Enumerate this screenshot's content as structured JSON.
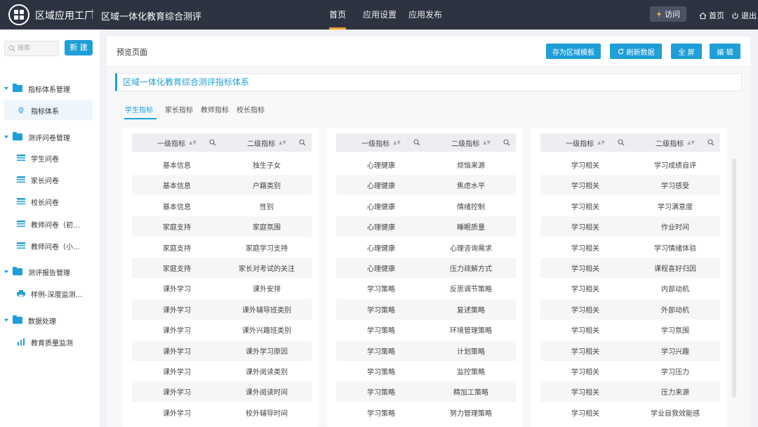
{
  "topbar": {
    "app_name": "区域应用工厂",
    "page_name": "区域一体化教育综合测评",
    "nav": [
      "首页",
      "应用设置",
      "应用发布"
    ],
    "visit_label": "访问",
    "home_label": "首页",
    "logout_label": "退出",
    "accent_color": "#f0a030"
  },
  "sidebar": {
    "search_placeholder": "搜索",
    "new_label": "新 建",
    "groups": [
      {
        "label": "指标体系管理",
        "items": [
          {
            "label": "指标体系",
            "icon": "pin-icon"
          }
        ]
      },
      {
        "label": "测评问卷管理",
        "items": [
          {
            "label": "学生问卷",
            "icon": "list-icon"
          },
          {
            "label": "家长问卷",
            "icon": "list-icon"
          },
          {
            "label": "校长问卷",
            "icon": "list-icon"
          },
          {
            "label": "教师问卷（初...",
            "icon": "list-icon"
          },
          {
            "label": "教师问卷（小...",
            "icon": "list-icon"
          }
        ]
      },
      {
        "label": "测评报告管理",
        "items": [
          {
            "label": "样例-深度监测...",
            "icon": "print-icon"
          }
        ]
      },
      {
        "label": "数据处理",
        "items": [
          {
            "label": "教育质量监测",
            "icon": "bar-chart-icon"
          }
        ]
      }
    ]
  },
  "main": {
    "preview_label": "预览页面",
    "buttons": [
      "存为区域模板",
      "刷新数据",
      "全 屏",
      "编 辑"
    ],
    "title": "区域一体化教育综合测评指标体系",
    "tabs": [
      "学生指标",
      "家长指标",
      "教师指标",
      "校长指标"
    ],
    "columns": [
      "一级指标",
      "二级指标"
    ],
    "panels": [
      {
        "rows": [
          [
            "基本信息",
            "独生子女"
          ],
          [
            "基本信息",
            "户籍类别"
          ],
          [
            "基本信息",
            "性别"
          ],
          [
            "家庭支持",
            "家庭氛围"
          ],
          [
            "家庭支持",
            "家庭学习支持"
          ],
          [
            "家庭支持",
            "家长对考试的关注"
          ],
          [
            "课外学习",
            "课外安排"
          ],
          [
            "课外学习",
            "课外辅导班类别"
          ],
          [
            "课外学习",
            "课外兴趣班类别"
          ],
          [
            "课外学习",
            "课外学习原因"
          ],
          [
            "课外学习",
            "课外阅读类别"
          ],
          [
            "课外学习",
            "课外阅读时间"
          ],
          [
            "课外学习",
            "校外辅导时间"
          ]
        ]
      },
      {
        "rows": [
          [
            "心理健康",
            "烦恼来源"
          ],
          [
            "心理健康",
            "焦虑水平"
          ],
          [
            "心理健康",
            "情绪控制"
          ],
          [
            "心理健康",
            "睡眠质量"
          ],
          [
            "心理健康",
            "心理咨询需求"
          ],
          [
            "心理健康",
            "压力疏解方式"
          ],
          [
            "学习策略",
            "反思调节策略"
          ],
          [
            "学习策略",
            "复述策略"
          ],
          [
            "学习策略",
            "环境管理策略"
          ],
          [
            "学习策略",
            "计划策略"
          ],
          [
            "学习策略",
            "监控策略"
          ],
          [
            "学习策略",
            "精加工策略"
          ],
          [
            "学习策略",
            "努力管理策略"
          ]
        ]
      },
      {
        "rows": [
          [
            "学习相关",
            "学习成绩自评"
          ],
          [
            "学习相关",
            "学习感受"
          ],
          [
            "学习相关",
            "学习满意度"
          ],
          [
            "学习相关",
            "作业时间"
          ],
          [
            "学习相关",
            "学习情绪体验"
          ],
          [
            "学习相关",
            "课程喜好归因"
          ],
          [
            "学习相关",
            "内部动机"
          ],
          [
            "学习相关",
            "外部动机"
          ],
          [
            "学习相关",
            "学习氛围"
          ],
          [
            "学习相关",
            "学习兴趣"
          ],
          [
            "学习相关",
            "学习压力"
          ],
          [
            "学习相关",
            "压力来源"
          ],
          [
            "学习相关",
            "学业自我效能感"
          ]
        ]
      }
    ]
  }
}
